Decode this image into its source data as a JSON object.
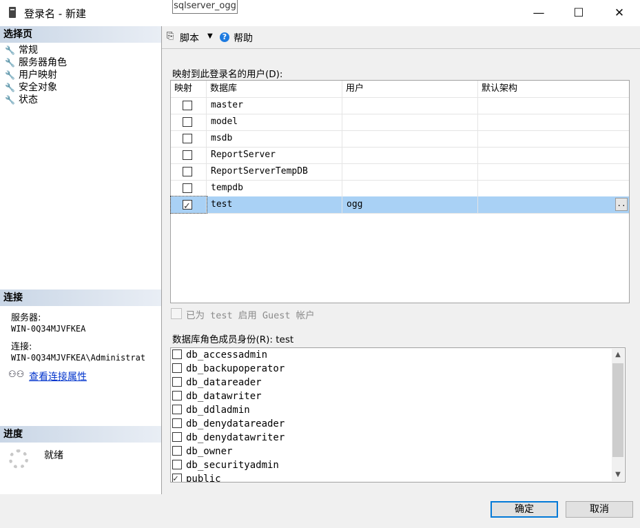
{
  "window": {
    "title": "登录名 - 新建",
    "tooltip": "sqlserver_ogg",
    "minimize": "—",
    "maximize": "☐",
    "close": "✕"
  },
  "left": {
    "select_page_header": "选择页",
    "pages": [
      "常规",
      "服务器角色",
      "用户映射",
      "安全对象",
      "状态"
    ],
    "connection_header": "连接",
    "server_label": "服务器:",
    "server_value": "WIN-0Q34MJVFKEA",
    "connection_label": "连接:",
    "connection_value": "WIN-0Q34MJVFKEA\\Administrat",
    "view_connection_link": "查看连接属性",
    "progress_header": "进度",
    "progress_status": "就绪"
  },
  "toolbar": {
    "script_label": "脚本",
    "help_label": "帮助"
  },
  "mapping": {
    "label": "映射到此登录名的用户(D):",
    "columns": [
      "映射",
      "数据库",
      "用户",
      "默认架构"
    ],
    "rows": [
      {
        "checked": false,
        "database": "master",
        "user": "",
        "schema": ""
      },
      {
        "checked": false,
        "database": "model",
        "user": "",
        "schema": ""
      },
      {
        "checked": false,
        "database": "msdb",
        "user": "",
        "schema": ""
      },
      {
        "checked": false,
        "database": "ReportServer",
        "user": "",
        "schema": ""
      },
      {
        "checked": false,
        "database": "ReportServerTempDB",
        "user": "",
        "schema": ""
      },
      {
        "checked": false,
        "database": "tempdb",
        "user": "",
        "schema": ""
      },
      {
        "checked": true,
        "database": "test",
        "user": "ogg",
        "schema": "",
        "selected": true
      }
    ],
    "ellipsis": ".."
  },
  "guest": {
    "label": "已为 test 启用 Guest 帐户"
  },
  "roles": {
    "label": "数据库角色成员身份(R): test",
    "items": [
      {
        "name": "db_accessadmin",
        "checked": false
      },
      {
        "name": "db_backupoperator",
        "checked": false
      },
      {
        "name": "db_datareader",
        "checked": false
      },
      {
        "name": "db_datawriter",
        "checked": false
      },
      {
        "name": "db_ddladmin",
        "checked": false
      },
      {
        "name": "db_denydatareader",
        "checked": false
      },
      {
        "name": "db_denydatawriter",
        "checked": false
      },
      {
        "name": "db_owner",
        "checked": false
      },
      {
        "name": "db_securityadmin",
        "checked": false
      },
      {
        "name": "public",
        "checked": true
      }
    ]
  },
  "buttons": {
    "ok": "确定",
    "cancel": "取消"
  }
}
